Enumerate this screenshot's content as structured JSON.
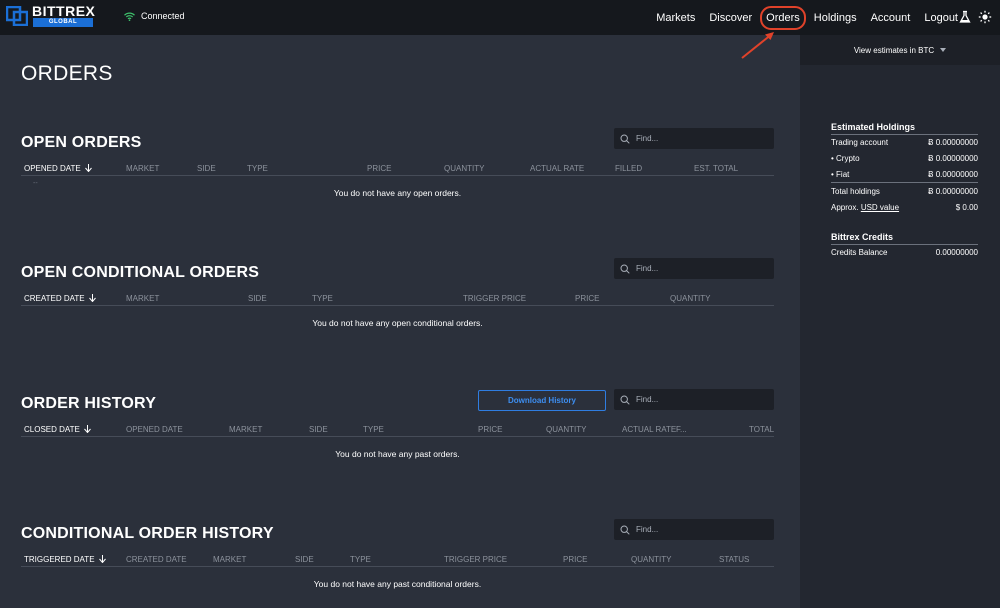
{
  "brand": {
    "name": "BITTREX",
    "sub": "GLOBAL"
  },
  "connection": {
    "status": "Connected"
  },
  "nav": {
    "items": [
      {
        "label": "Markets"
      },
      {
        "label": "Discover"
      },
      {
        "label": "Orders"
      },
      {
        "label": "Holdings"
      },
      {
        "label": "Account"
      },
      {
        "label": "Logout"
      }
    ],
    "active": "Orders",
    "icons": [
      "flask-icon",
      "sun-icon"
    ]
  },
  "page": {
    "title": "ORDERS"
  },
  "sections": {
    "open_orders": {
      "title": "OPEN ORDERS",
      "find_placeholder": "Find...",
      "columns": [
        "OPENED DATE",
        "MARKET",
        "SIDE",
        "TYPE",
        "PRICE",
        "QUANTITY",
        "ACTUAL RATE",
        "FILLED",
        "EST. TOTAL"
      ],
      "dash": "--",
      "empty": "You do not have any open orders."
    },
    "open_conditional": {
      "title": "OPEN CONDITIONAL ORDERS",
      "find_placeholder": "Find...",
      "columns": [
        "CREATED DATE",
        "MARKET",
        "SIDE",
        "TYPE",
        "TRIGGER PRICE",
        "PRICE",
        "QUANTITY"
      ],
      "empty": "You do not have any open conditional orders."
    },
    "order_history": {
      "title": "ORDER HISTORY",
      "download_label": "Download History",
      "find_placeholder": "Find...",
      "columns": [
        "CLOSED DATE",
        "OPENED DATE",
        "MARKET",
        "SIDE",
        "TYPE",
        "PRICE",
        "QUANTITY",
        "ACTUAL RATE",
        "F...",
        "TOTAL"
      ],
      "empty": "You do not have any past orders."
    },
    "conditional_history": {
      "title": "CONDITIONAL ORDER HISTORY",
      "find_placeholder": "Find...",
      "columns": [
        "TRIGGERED DATE",
        "CREATED DATE",
        "MARKET",
        "SIDE",
        "TYPE",
        "TRIGGER PRICE",
        "PRICE",
        "QUANTITY",
        "STATUS"
      ],
      "empty": "You do not have any past conditional orders."
    }
  },
  "sidebar": {
    "estimates_label": "View estimates in BTC",
    "holdings": {
      "title": "Estimated Holdings",
      "rows": [
        {
          "label": "Trading account",
          "value": "Ƀ 0.00000000"
        },
        {
          "label": "• Crypto",
          "value": "Ƀ 0.00000000"
        },
        {
          "label": "• Fiat",
          "value": "Ƀ 0.00000000"
        },
        {
          "label": "Total holdings",
          "value": "Ƀ 0.00000000"
        }
      ],
      "approx_label": "Approx.",
      "approx_link": "USD value",
      "approx_value": "$ 0.00"
    },
    "credits": {
      "title": "Bittrex Credits",
      "balance_label": "Credits Balance",
      "balance_value": "0.00000000"
    }
  },
  "colors": {
    "accent": "#2f7de1",
    "highlight": "#e0422a",
    "connected": "#3ec46d"
  }
}
